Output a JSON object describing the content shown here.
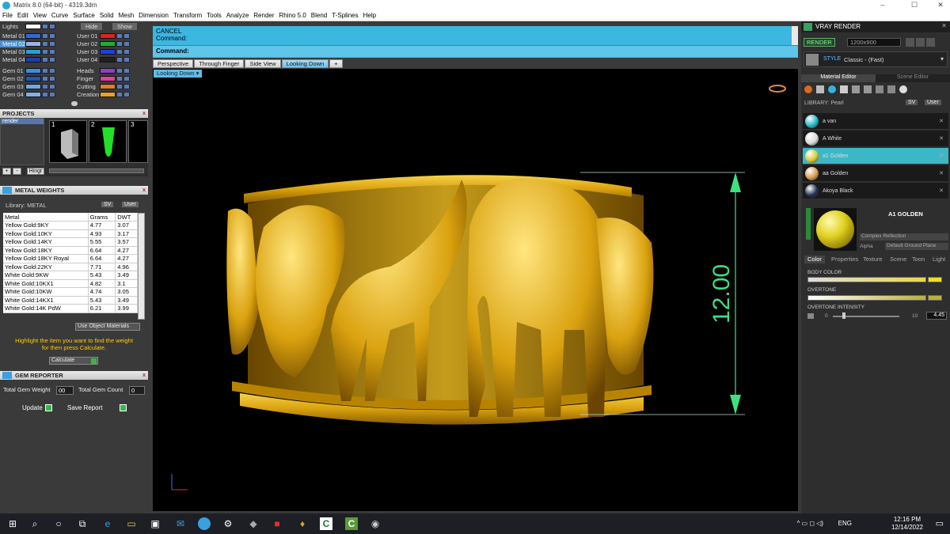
{
  "window": {
    "title": "Matrix 8.0 (64-bit) - 4319.3dm",
    "min": "–",
    "max": "☐",
    "close": "✕"
  },
  "menu": [
    "File",
    "Edit",
    "View",
    "Curve",
    "Surface",
    "Solid",
    "Mesh",
    "Dimension",
    "Transform",
    "Tools",
    "Analyze",
    "Render",
    "Rhino 5.0",
    "Blend",
    "T-Splines",
    "Help"
  ],
  "layers": {
    "lights_label": "Lights",
    "hide_label": "Hide",
    "show_label": "Show",
    "left": [
      {
        "name": "Metal 01",
        "color": "#2e6ad8"
      },
      {
        "name": "Metal 02",
        "color": "#9ab4e8",
        "selected": true
      },
      {
        "name": "Metal 03",
        "color": "#2a9ed8"
      },
      {
        "name": "Metal 04",
        "color": "#1c3fa8"
      },
      {
        "name": "Gem 01",
        "color": "#3e8de0"
      },
      {
        "name": "Gem 02",
        "color": "#1e58b8"
      },
      {
        "name": "Gem 03",
        "color": "#6fa8e8"
      },
      {
        "name": "Gem 04",
        "color": "#7fb0ee"
      }
    ],
    "right": [
      {
        "name": "User 01",
        "color": "#e02020"
      },
      {
        "name": "User 02",
        "color": "#20b030"
      },
      {
        "name": "User 03",
        "color": "#2040e0"
      },
      {
        "name": "User 04",
        "color": "#202020"
      },
      {
        "name": "Heads",
        "color": "#9040c0"
      },
      {
        "name": "Finger",
        "color": "#e040a0"
      },
      {
        "name": "Cutting",
        "color": "#e08020"
      },
      {
        "name": "Creation",
        "color": "#f0a020"
      }
    ]
  },
  "projects": {
    "title": "PROJECTS",
    "list_item": "render",
    "thumbs": [
      "1",
      "2",
      "3"
    ],
    "add": "+",
    "remove": "-",
    "hinge": "Hingr"
  },
  "metal_weights": {
    "title": "METAL WEIGHTS",
    "library_label": "Library: METAL",
    "sv": "SV",
    "user": "User",
    "headers": [
      "Metal",
      "Grams",
      "DWT"
    ],
    "rows": [
      [
        "Yellow Gold:9KY",
        "4.77",
        "3.07"
      ],
      [
        "Yellow Gold:10KY",
        "4.93",
        "3.17"
      ],
      [
        "Yellow Gold:14KY",
        "5.55",
        "3.57"
      ],
      [
        "Yellow Gold:18KY",
        "6.64",
        "4.27"
      ],
      [
        "Yellow Gold:18KY Royal",
        "6.64",
        "4.27"
      ],
      [
        "Yellow Gold:22KY",
        "7.71",
        "4.96"
      ],
      [
        "White Gold:9KW",
        "5.43",
        "3.49"
      ],
      [
        "White Gold:10KX1",
        "4.82",
        "3.1"
      ],
      [
        "White Gold:10KW",
        "4.74",
        "3.05"
      ],
      [
        "White Gold:14KX1",
        "5.43",
        "3.49"
      ],
      [
        "White Gold:14K PdW",
        "6.21",
        "3.99"
      ]
    ],
    "use_object": "Use Object Materials",
    "hint1": "Highlight the item you want to find the weight",
    "hint2": "for then press Calculate.",
    "calculate": "Calculate"
  },
  "gem_reporter": {
    "title": "GEM REPORTER",
    "total_weight_label": "Total Gem Weight",
    "total_weight": "00",
    "total_count_label": "Total Gem Count",
    "total_count": "0",
    "update": "Update",
    "save_report": "Save Report"
  },
  "command": {
    "line1": "CANCEL",
    "line2": "Command:",
    "line3": "Command:"
  },
  "viewport_tabs": [
    "Perspective",
    "Through Finger",
    "Side View",
    "Looking Down"
  ],
  "active_tab": "Looking Down",
  "viewport_label": "Looking Down",
  "dimension": "12.00",
  "vray": {
    "title": "VRAY RENDER",
    "render_btn": "RENDER",
    "resolution": "1200x900",
    "style_label": "STYLE",
    "style_value": "Classic - (Fast)",
    "tabs": [
      "Material Editor",
      "Scene Editor"
    ],
    "library_label": "LIBRARY: Pearl",
    "sv": "SV",
    "user": "User",
    "materials": [
      {
        "name": "a van",
        "color": "#1fb8c8"
      },
      {
        "name": "A White",
        "color": "#d8d8d8"
      },
      {
        "name": "a1 Golden",
        "color": "#d8c830",
        "selected": true
      },
      {
        "name": "aa Golden",
        "color": "#d89a50"
      },
      {
        "name": "Akoya Black",
        "color": "#203050"
      }
    ],
    "preview_name": "A1 GOLDEN",
    "reflection": "Complex Reflection",
    "alpha_label": "Alpha",
    "ground": "Default Ground Plane",
    "sub_tabs": [
      "Color",
      "Properties",
      "Texture",
      "Scene",
      "Toon",
      "Light"
    ],
    "body_color_label": "BODY COLOR",
    "overtone_label": "OVERTONE",
    "intensity_label": "OVERTONE INTENSITY",
    "intensity_min": "0",
    "intensity_max": "10",
    "intensity_value": "4.45",
    "body_color": "#f0e020",
    "overtone_color": "#b8b040"
  },
  "taskbar": {
    "lang": "ENG",
    "time": "12:16 PM",
    "date": "12/14/2022"
  }
}
